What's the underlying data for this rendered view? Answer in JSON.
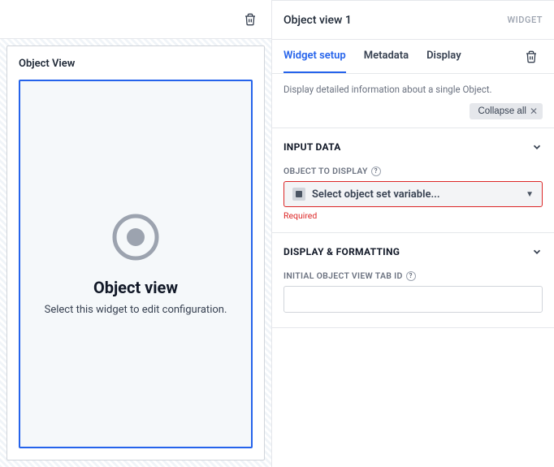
{
  "left": {
    "card_title": "Object View",
    "preview_title": "Object view",
    "preview_subtitle": "Select this widget to edit configuration."
  },
  "right": {
    "title": "Object view 1",
    "badge": "WIDGET",
    "tabs": {
      "setup": "Widget setup",
      "metadata": "Metadata",
      "display": "Display"
    },
    "description": "Display detailed information about a single Object.",
    "collapse_label": "Collapse all",
    "sections": {
      "input": {
        "header": "INPUT DATA",
        "field_label": "OBJECT TO DISPLAY",
        "placeholder": "Select object set variable...",
        "required_msg": "Required"
      },
      "display": {
        "header": "DISPLAY & FORMATTING",
        "field_label": "INITIAL OBJECT VIEW TAB ID",
        "value": ""
      }
    }
  }
}
